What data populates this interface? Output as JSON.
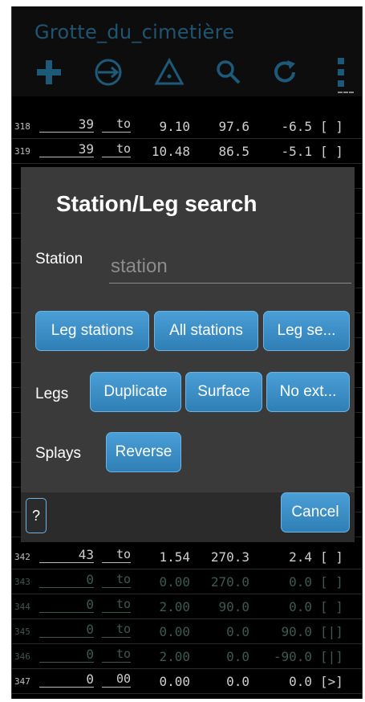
{
  "app": {
    "title": "Grotte_du_cimetière"
  },
  "toolbar": {
    "icons": [
      "plus-icon",
      "circle-arrow-icon",
      "triangle-dot-icon",
      "search-icon",
      "refresh-icon",
      "overflow-menu-icon"
    ]
  },
  "rows": [
    {
      "idx": "318",
      "from": "39",
      "to": "to",
      "len": "9.10",
      "az": "97.6",
      "cl": "-6.5",
      "fl": "[ ]"
    },
    {
      "idx": "319",
      "from": "39",
      "to": "to",
      "len": "10.48",
      "az": "86.5",
      "cl": "-5.1",
      "fl": "[ ]"
    },
    {
      "idx": "342",
      "from": "43",
      "to": "to",
      "len": "1.54",
      "az": "270.3",
      "cl": "2.4",
      "fl": "[ ]"
    },
    {
      "idx": "343",
      "from": "0",
      "to": "to",
      "len": "0.00",
      "az": "270.0",
      "cl": "0.0",
      "fl": "[ ]"
    },
    {
      "idx": "344",
      "from": "0",
      "to": "to",
      "len": "2.00",
      "az": "90.0",
      "cl": "0.0",
      "fl": "[ ]"
    },
    {
      "idx": "345",
      "from": "0",
      "to": "to",
      "len": "0.00",
      "az": "0.0",
      "cl": "90.0",
      "fl": "[|]"
    },
    {
      "idx": "346",
      "from": "0",
      "to": "to",
      "len": "2.00",
      "az": "0.0",
      "cl": "-90.0",
      "fl": "[|]"
    },
    {
      "idx": "347",
      "from": "0",
      "to": "00",
      "len": "0.00",
      "az": "0.0",
      "cl": "0.0",
      "fl": "[>]"
    }
  ],
  "dialog": {
    "title": "Station/Leg search",
    "station_label": "Station",
    "station_placeholder": "station",
    "station_value": "",
    "buttons_row1": [
      "Leg stations",
      "All stations",
      "Leg se..."
    ],
    "legs_label": "Legs",
    "buttons_legs": [
      "Duplicate",
      "Surface",
      "No ext..."
    ],
    "splays_label": "Splays",
    "buttons_splays": [
      "Reverse"
    ],
    "help_label": "?",
    "cancel_label": "Cancel"
  },
  "colors": {
    "accent": "#3d8fc9",
    "title_text": "#1f5572",
    "toolbar_icon": "#1d5a7a"
  }
}
